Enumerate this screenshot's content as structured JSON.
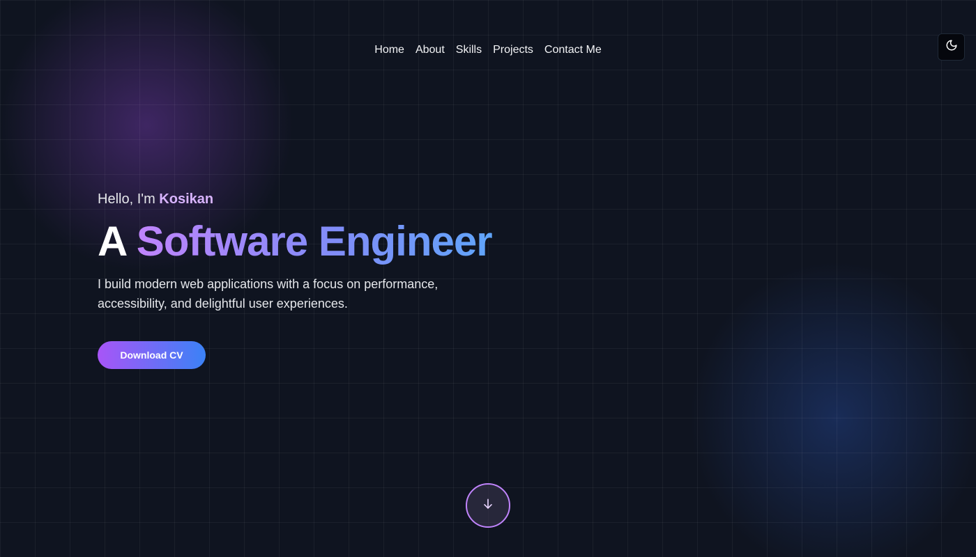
{
  "nav": {
    "items": [
      {
        "label": "Home"
      },
      {
        "label": "About"
      },
      {
        "label": "Skills"
      },
      {
        "label": "Projects"
      },
      {
        "label": "Contact Me"
      }
    ]
  },
  "theme_toggle": {
    "icon": "moon-icon"
  },
  "hero": {
    "greeting_prefix": "Hello, I'm ",
    "name": "Kosikan",
    "headline_plain": "A ",
    "headline_gradient": "Software Engineer",
    "tagline": "I build modern web applications with a focus on performance, accessibility, and delightful user experiences.",
    "cta_label": "Download CV"
  },
  "scroll_indicator": {
    "icon": "arrow-down-icon"
  },
  "colors": {
    "background": "#0f1420",
    "accent_purple": "#c084fc",
    "accent_blue": "#60a5fa",
    "name_highlight": "#d8b4fe"
  }
}
